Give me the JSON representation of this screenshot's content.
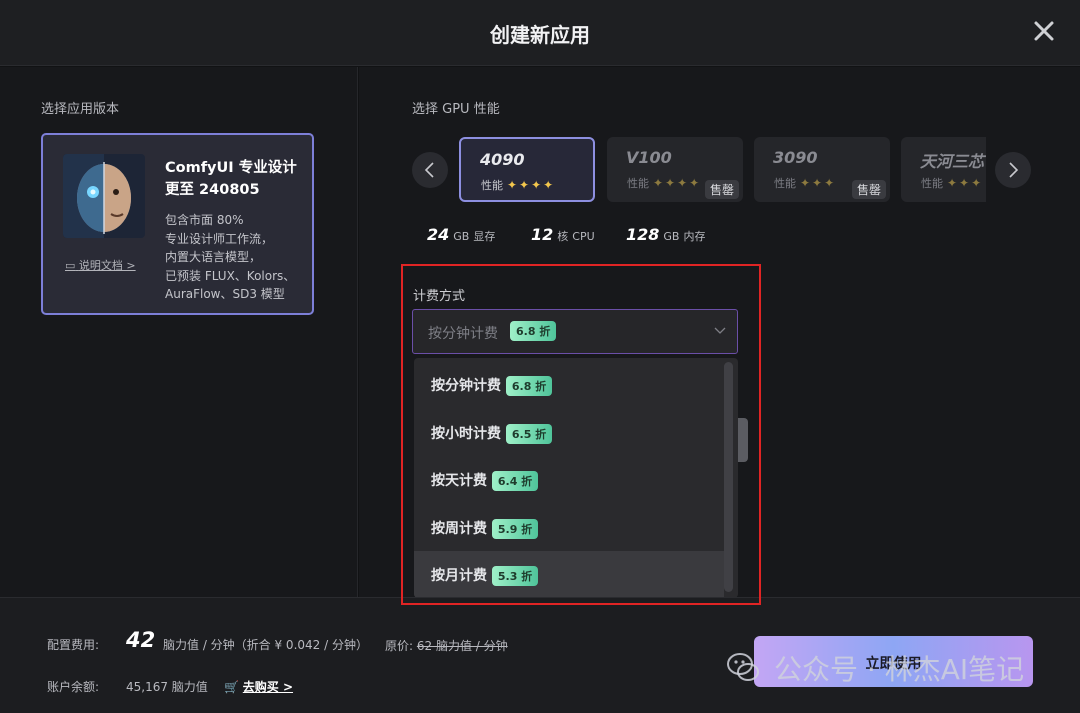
{
  "dialog": {
    "title": "创建新应用"
  },
  "left": {
    "section_label": "选择应用版本",
    "version": {
      "title_line1": "ComfyUI 专业设计",
      "title_line2": "更至 240805",
      "desc_lines": [
        "包含市面 80%",
        "专业设计师工作流，",
        "内置大语言模型，",
        "已预装 FLUX、Kolors、",
        "AuraFlow、SD3 模型"
      ],
      "doc_link": "说明文档 >"
    }
  },
  "gpu": {
    "section_label": "选择 GPU 性能",
    "cards": [
      {
        "name": "4090",
        "perf_label": "性能",
        "stars": "✦✦✦✦",
        "stars_count": 4,
        "selected": true
      },
      {
        "name": "V100",
        "perf_label": "性能",
        "stars": "✦✦✦✦",
        "stars_count": 4,
        "sold_out": "售罄"
      },
      {
        "name": "3090",
        "perf_label": "性能",
        "stars": "✦✦✦",
        "stars_count": 3,
        "sold_out": "售罄"
      },
      {
        "name": "天河三芯",
        "perf_label": "性能",
        "stars": "✦✦✦",
        "stars_count": 3
      }
    ],
    "specs": [
      {
        "value": "24",
        "unit": "GB",
        "label": "显存"
      },
      {
        "value": "12",
        "unit": "核",
        "label": "CPU"
      },
      {
        "value": "128",
        "unit": "GB",
        "label": "内存"
      }
    ]
  },
  "billing": {
    "label": "计费方式",
    "selected": "按分钟计费",
    "selected_discount": "6.8 折",
    "options": [
      {
        "label": "按分钟计费",
        "discount": "6.8 折"
      },
      {
        "label": "按小时计费",
        "discount": "6.5 折"
      },
      {
        "label": "按天计费",
        "discount": "6.4 折"
      },
      {
        "label": "按周计费",
        "discount": "5.9 折"
      },
      {
        "label": "按月计费",
        "discount": "5.3 折"
      }
    ]
  },
  "footer": {
    "cost_label": "配置费用:",
    "cost_value": "42",
    "cost_detail": "脑力值 / 分钟（折合 ¥ 0.042 / 分钟）",
    "original_label": "原价:",
    "original_value": "62 脑力值 / 分钟",
    "balance_label": "账户余额:",
    "balance_value": "45,167 脑力值",
    "buy_link": "去购买 >",
    "cta": "立即使用"
  },
  "watermark": {
    "text": "公众号 · 林杰AI笔记"
  },
  "colors": {
    "accent": "#8d8fe0",
    "badge": "#4fc49a",
    "highlight": "#e02424"
  }
}
